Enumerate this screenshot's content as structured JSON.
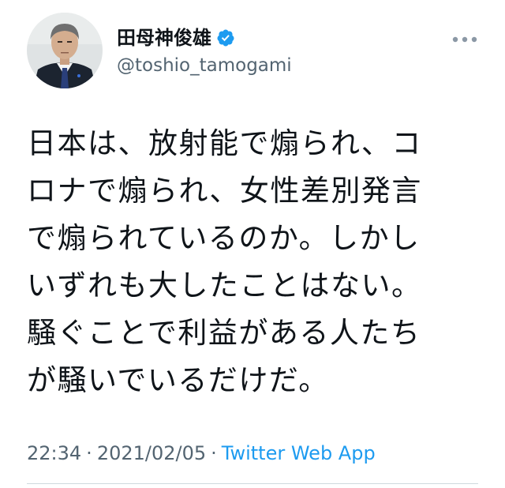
{
  "author": {
    "display_name": "田母神俊雄",
    "handle": "@toshio_tamogami",
    "verified": true,
    "avatar_icon": "profile-photo",
    "verified_icon": "verified-badge-icon"
  },
  "tweet": {
    "text_lines": [
      "日本は、放射能で煽られ、コ",
      "ロナで煽られ、女性差別発言",
      "で煽られているのか。しかし",
      "いずれも大したことはない。",
      "騒ぐことで利益がある人たち",
      "が騒いでいるだけだ。"
    ]
  },
  "meta": {
    "time": "22:34",
    "separator": "·",
    "date": "2021/02/05",
    "source": "Twitter Web App"
  },
  "colors": {
    "text": "#0f1419",
    "secondary": "#536471",
    "accent": "#1d9bf0",
    "divider": "#cfd9de"
  },
  "icons": {
    "more": "more-horizontal-icon"
  }
}
